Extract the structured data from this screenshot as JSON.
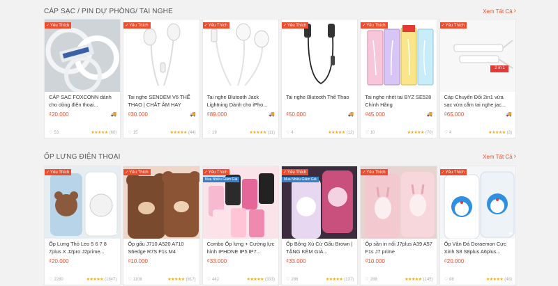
{
  "sections": [
    {
      "title": "CÁP SẠC / PIN DỰ PHÒNG/ TAI NGHE",
      "see_all": "Xem Tất Cả",
      "products": [
        {
          "badge": "Yêu Thích",
          "name": "CÁP SẠC FOXCONN dành cho dòng điện thoại...",
          "price": "₫20.000",
          "likes": "53",
          "rating_count": "(60)",
          "stars": "★★★★★",
          "icon": "cable-coils-image"
        },
        {
          "badge": "Yêu Thích",
          "name": "Tai nghe SENDEM V6 THỂ THAO | CHẤT ÂM HAY",
          "price": "₫30.000",
          "likes": "15",
          "rating_count": "(44)",
          "stars": "★★★★★",
          "icon": "white-earphones-image"
        },
        {
          "badge": "Yêu Thích",
          "name": "Tai nghe Blutooth Jack Lightning Dành cho iPho...",
          "price": "₫89.000",
          "likes": "19",
          "rating_count": "(11)",
          "stars": "★★★★★",
          "icon": "lightning-earpods-image"
        },
        {
          "badge": "Yêu Thích",
          "name": "Tai nghe Blutooth Thể Thao",
          "price": "₫50.000",
          "likes": "4",
          "rating_count": "(12)",
          "stars": "★★★★★",
          "icon": "black-earphones-image"
        },
        {
          "badge": "Yêu Thích",
          "name": "Tai nghe nhét tai BYZ SE528 Chính Hãng",
          "price": "₫45.000",
          "likes": "10",
          "rating_count": "(70)",
          "stars": "★★★★★",
          "icon": "boxed-earphones-image"
        },
        {
          "badge": "Yêu Thích",
          "name": "Cáp Chuyển Đổi 2in1 vừa sạc vừa cắm tai nghe jac...",
          "price": "₫65.000",
          "likes": "4",
          "rating_count": "(3)",
          "stars": "★★★★★",
          "icon": "adapter-cable-image",
          "tag": "2 in 1"
        }
      ]
    },
    {
      "title": "ỐP LƯNG ĐIỆN THOẠI",
      "see_all": "Xem Tất Cả",
      "products": [
        {
          "badge": "Yêu Thích",
          "name": "Ốp Lưng Thỏ Leo 5 6 7 8 7plus X J2pro J2prime...",
          "price": "₫20.000",
          "likes": "2280",
          "rating_count": "(1847)",
          "stars": "★★★★★",
          "icon": "brown-bear-case-image"
        },
        {
          "badge": "Yêu Thích",
          "name": "Ốp gấu J710 A520 A710 S6edge R7S F1s M4",
          "price": "₫10.000",
          "likes": "1108",
          "rating_count": "(617)",
          "stars": "★★★★★",
          "icon": "bear-ear-case-image"
        },
        {
          "badge": "Yêu Thích",
          "promo": "Mua Nhiều Giảm Giá",
          "name": "Combo Ốp lưng + Cường lực hình IPHONE IP5 IP7...",
          "price": "₫33.000",
          "likes": "442",
          "rating_count": "(333)",
          "stars": "★★★★★",
          "icon": "cartoon-cases-image"
        },
        {
          "badge": "Yêu Thích",
          "promo": "Mua Nhiều Giảm Giá",
          "name": "Ốp Bông Xù Cừ Gấu Brown | TẶNG KÈM GIÁ...",
          "price": "₫33.000",
          "likes": "286",
          "rating_count": "(137)",
          "stars": "★★★★★",
          "icon": "fluffy-case-image"
        },
        {
          "badge": "Yêu Thích",
          "name": "Ốp sần in nổi J7plus A39 A57 F1s J7 prime",
          "price": "₫10.000",
          "likes": "288",
          "rating_count": "(145)",
          "stars": "★★★★★",
          "icon": "pink-bunny-case-image"
        },
        {
          "badge": "Yêu Thích",
          "name": "Ốp Vân Đá Doraemon Cực Xinh S8 S8plus A6plus...",
          "price": "₫20.000",
          "likes": "98",
          "rating_count": "(48)",
          "stars": "★★★★★",
          "icon": "doraemon-case-image"
        }
      ]
    }
  ]
}
